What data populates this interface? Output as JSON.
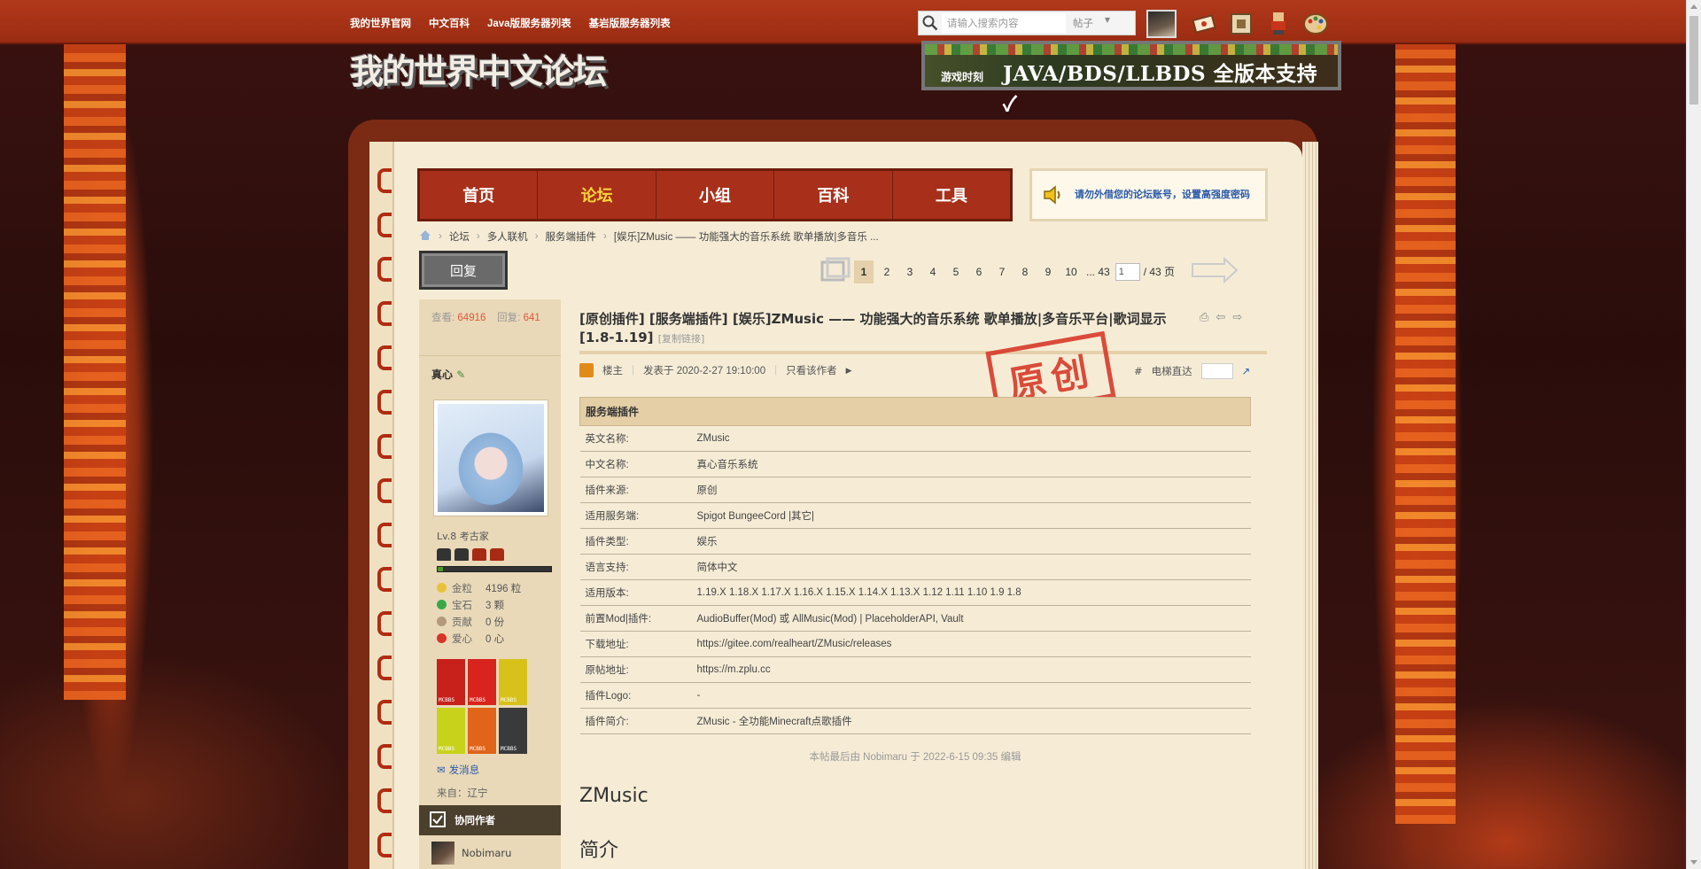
{
  "topbar": {
    "links": [
      "我的世界官网",
      "中文百科",
      "Java版服务器列表",
      "基岩版服务器列表"
    ],
    "search_placeholder": "请输入搜索内容",
    "search_type": "帖子"
  },
  "header": {
    "logo_text": "我的世界中文论坛",
    "banner_sub": "游戏时刻",
    "banner_text": "JAVA/BDS/LLBDS 全版本支持 ✓"
  },
  "mainnav": {
    "tabs": [
      "首页",
      "论坛",
      "小组",
      "百科",
      "工具"
    ],
    "active": "论坛"
  },
  "notice": "请勿外借您的论坛账号，设置高强度密码",
  "breadcrumb": [
    "论坛",
    "多人联机",
    "服务端插件",
    "[娱乐]ZMusic —— 功能强大的音乐系统 歌单播放|多音乐 ..."
  ],
  "reply_button": "回复",
  "pager": {
    "pages": [
      "1",
      "2",
      "3",
      "4",
      "5",
      "6",
      "7",
      "8",
      "9",
      "10",
      "... 43"
    ],
    "current": "1",
    "input_value": "1",
    "total": "/ 43 页"
  },
  "author": {
    "views_label": "查看:",
    "views": "64916",
    "replies_label": "回复:",
    "replies": "641",
    "name": "真心",
    "level": "Lv.8 考古家",
    "exp_progress": 0.05,
    "credits": [
      {
        "key": "金粒",
        "value": "4196 粒",
        "color": "#e8c23a"
      },
      {
        "key": "宝石",
        "value": "3 颗",
        "color": "#3aa84a"
      },
      {
        "key": "贡献",
        "value": "0 份",
        "color": "#b49a7a"
      },
      {
        "key": "爱心",
        "value": "0 心",
        "color": "#d8342a"
      }
    ],
    "send_message": "发消息",
    "from": "来自：辽宁",
    "coauthor_heading": "协同作者",
    "coauthor": "Nobimaru"
  },
  "post": {
    "title": "[原创插件] [服务端插件] [娱乐]ZMusic —— 功能强大的音乐系统 歌单播放|多音乐平台|歌词显示 [1.8-1.19]",
    "copy_link": "[复制链接]",
    "floor_label": "楼主",
    "posted_at": "发表于 2020-2-27 19:10:00",
    "only_author": "只看该作者",
    "floor_hash": "#",
    "elevator": "电梯直达",
    "stamp": "原创",
    "table_heading": "服务端插件",
    "info": [
      {
        "k": "英文名称:",
        "v": "ZMusic"
      },
      {
        "k": "中文名称:",
        "v": "真心音乐系统"
      },
      {
        "k": "插件来源:",
        "v": "原创"
      },
      {
        "k": "适用服务端:",
        "v": "Spigot BungeeCord |其它|"
      },
      {
        "k": "插件类型:",
        "v": "娱乐"
      },
      {
        "k": "语言支持:",
        "v": "简体中文"
      },
      {
        "k": "适用版本:",
        "v": "1.19.X 1.18.X 1.17.X 1.16.X 1.15.X 1.14.X 1.13.X 1.12 1.11 1.10 1.9 1.8"
      },
      {
        "k": "前置Mod|插件:",
        "v": "AudioBuffer(Mod) 或 AllMusic(Mod) | PlaceholderAPI, Vault"
      },
      {
        "k": "下载地址:",
        "v": "https://gitee.com/realheart/ZMusic/releases"
      },
      {
        "k": "原帖地址:",
        "v": "https://m.zplu.cc"
      },
      {
        "k": "插件Logo:",
        "v": "-"
      },
      {
        "k": "插件简介:",
        "v": "ZMusic - 全功能Minecraft点歌插件"
      }
    ],
    "edited": "本帖最后由 Nobimaru 于 2022-6-15 09:35 编辑",
    "heading1": "ZMusic",
    "heading2": "简介"
  }
}
